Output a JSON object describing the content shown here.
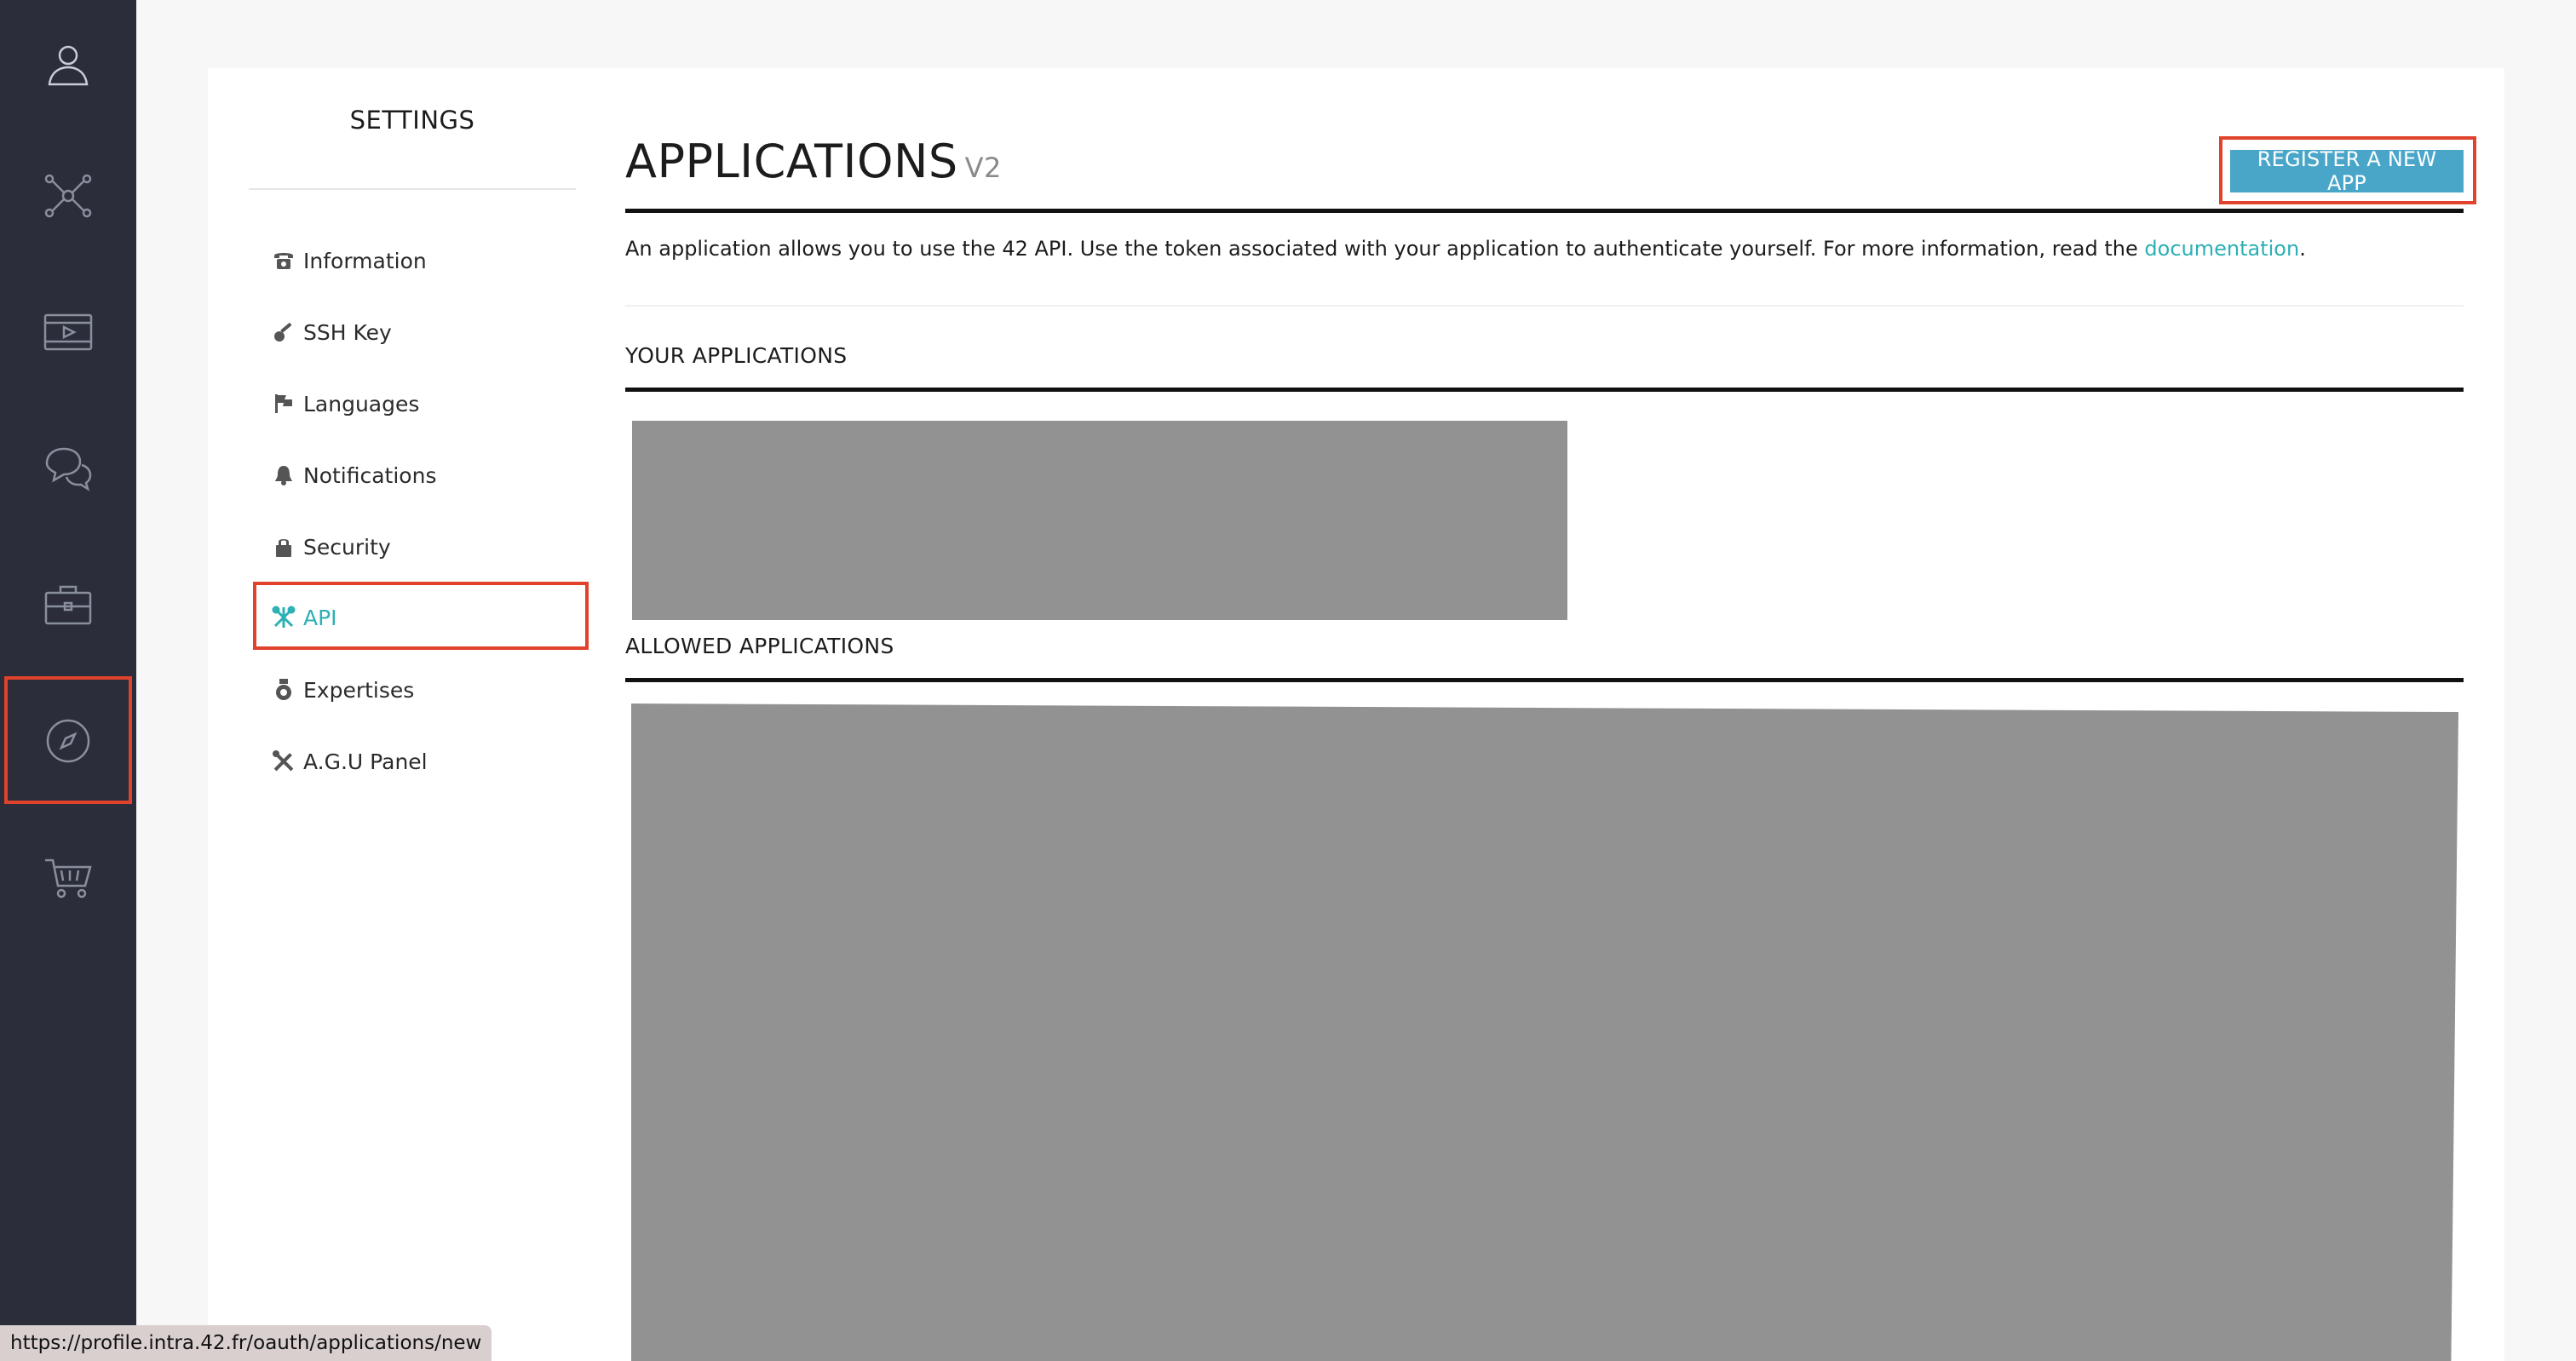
{
  "nav": {
    "items": [
      {
        "icon": "user-icon"
      },
      {
        "icon": "network-icon"
      },
      {
        "icon": "video-icon"
      },
      {
        "icon": "chat-icon"
      },
      {
        "icon": "briefcase-icon"
      },
      {
        "icon": "compass-icon"
      },
      {
        "icon": "cart-icon"
      }
    ]
  },
  "settings": {
    "title": "SETTINGS",
    "menu": [
      {
        "label": "Information",
        "icon": "phone-icon"
      },
      {
        "label": "SSH Key",
        "icon": "key-icon"
      },
      {
        "label": "Languages",
        "icon": "flag-icon"
      },
      {
        "label": "Notifications",
        "icon": "bell-icon"
      },
      {
        "label": "Security",
        "icon": "lock-icon"
      },
      {
        "label": "API",
        "icon": "tools-icon",
        "active": true
      },
      {
        "label": "Expertises",
        "icon": "medal-icon"
      },
      {
        "label": "A.G.U Panel",
        "icon": "wrench-icon"
      }
    ]
  },
  "main": {
    "title": "APPLICATIONS",
    "version": "V2",
    "register_label": "REGISTER A NEW APP",
    "intro_text": "An application allows you to use the 42 API. Use the token associated with your application to authenticate yourself. For more information, read the ",
    "intro_link": "documentation",
    "intro_end": ".",
    "your_apps_label": "YOUR APPLICATIONS",
    "allowed_apps_label": "ALLOWED APPLICATIONS"
  },
  "status_url": "https://profile.intra.42.fr/oauth/applications/new",
  "colors": {
    "accent": "#2bb0b5",
    "button": "#4aa6c9",
    "highlight": "#e0422c",
    "sidebar": "#2b2e3a",
    "redacted": "#929292"
  }
}
